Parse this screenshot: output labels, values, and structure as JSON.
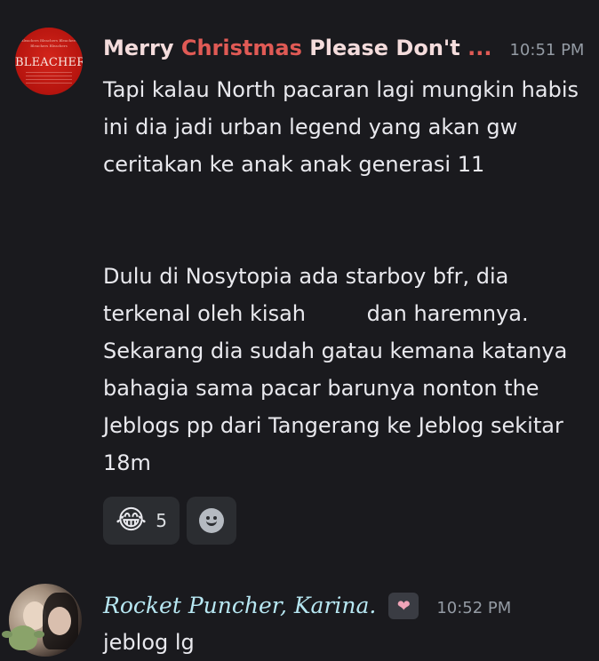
{
  "messages": [
    {
      "avatar": {
        "icon": "bleachers-album-avatar",
        "tiny_line1": "Bleachers Bleachers Bleachers",
        "tiny_line2": "Bleachers Bleachers",
        "brand_text": "BLEACHERS"
      },
      "username_white_1": "Merry ",
      "username_red_1": "Christmas",
      "username_white_2": " Please Don't",
      "username_red_2": " ...",
      "timestamp": "10:51 PM",
      "paragraph1": "Tapi kalau North pacaran lagi mungkin habis ini dia jadi urban legend yang akan gw ceritakan ke anak anak generasi 11",
      "paragraph2": "Dulu di Nosytopia ada starboy bfr, dia terkenal oleh kisah         dan haremnya. Sekarang dia sudah gatau kemana katanya bahagia sama pacar barunya nonton the Jeblogs pp dari Tangerang ke Jeblog sekitar 18m",
      "reactions": [
        {
          "emoji": "😂",
          "icon": "joy-emoji",
          "count": "5"
        }
      ],
      "add_reaction_icon": "smiley-add-reaction-icon"
    },
    {
      "avatar": {
        "icon": "group-photo-avatar",
        "decoration_icon": "baby-yoda-decoration"
      },
      "username": "Rocket Puncher, Karina.",
      "badge": {
        "icon": "heart-badge-icon",
        "glyph": "❤"
      },
      "timestamp": "10:52 PM",
      "text": "jeblog lg"
    }
  ],
  "colors": {
    "background": "#1a1a1e",
    "username_red": "#e05a55",
    "username2_color": "#b7e7f2",
    "timestamp": "#949ba4"
  }
}
